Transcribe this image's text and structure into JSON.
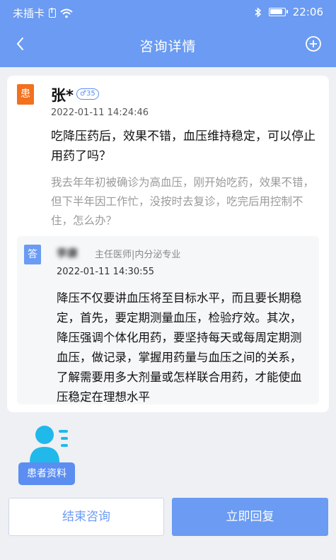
{
  "status_bar": {
    "carrier": "未插卡",
    "time": "22:06"
  },
  "nav": {
    "title": "咨询详情"
  },
  "question": {
    "badge": "患",
    "name": "张*",
    "gender_age": "♂35",
    "time": "2022-01-11 14:24:46",
    "text": "吃降压药后，效果不错，血压维持稳定，可以停止用药了吗？",
    "detail": "我去年年初被确诊为高血压，刚开始吃药，效果不错，但下半年因工作忙，没按时去复诊，吃完后用控制不住，怎么办？"
  },
  "answer": {
    "badge": "答",
    "doctor_name": "李康",
    "doctor_title": "主任医师|内分泌专业",
    "time": "2022-01-11 14:30:55",
    "text": "降压不仅要讲血压将至目标水平，而且要长期稳定，首先，要定期测量血压，检验疗效。其次，降压强调个体化用药，要坚持每天或每周定期测血压，做记录，掌握用药量与血压之间的关系，了解需要用多大剂量或怎样联合用药，才能使血压稳定在理想水平"
  },
  "patient_info": {
    "label": "患者资料"
  },
  "buttons": {
    "end": "结束咨询",
    "reply": "立即回复"
  },
  "colors": {
    "primary": "#6b9bf2",
    "patient_badge": "#f2701e"
  }
}
